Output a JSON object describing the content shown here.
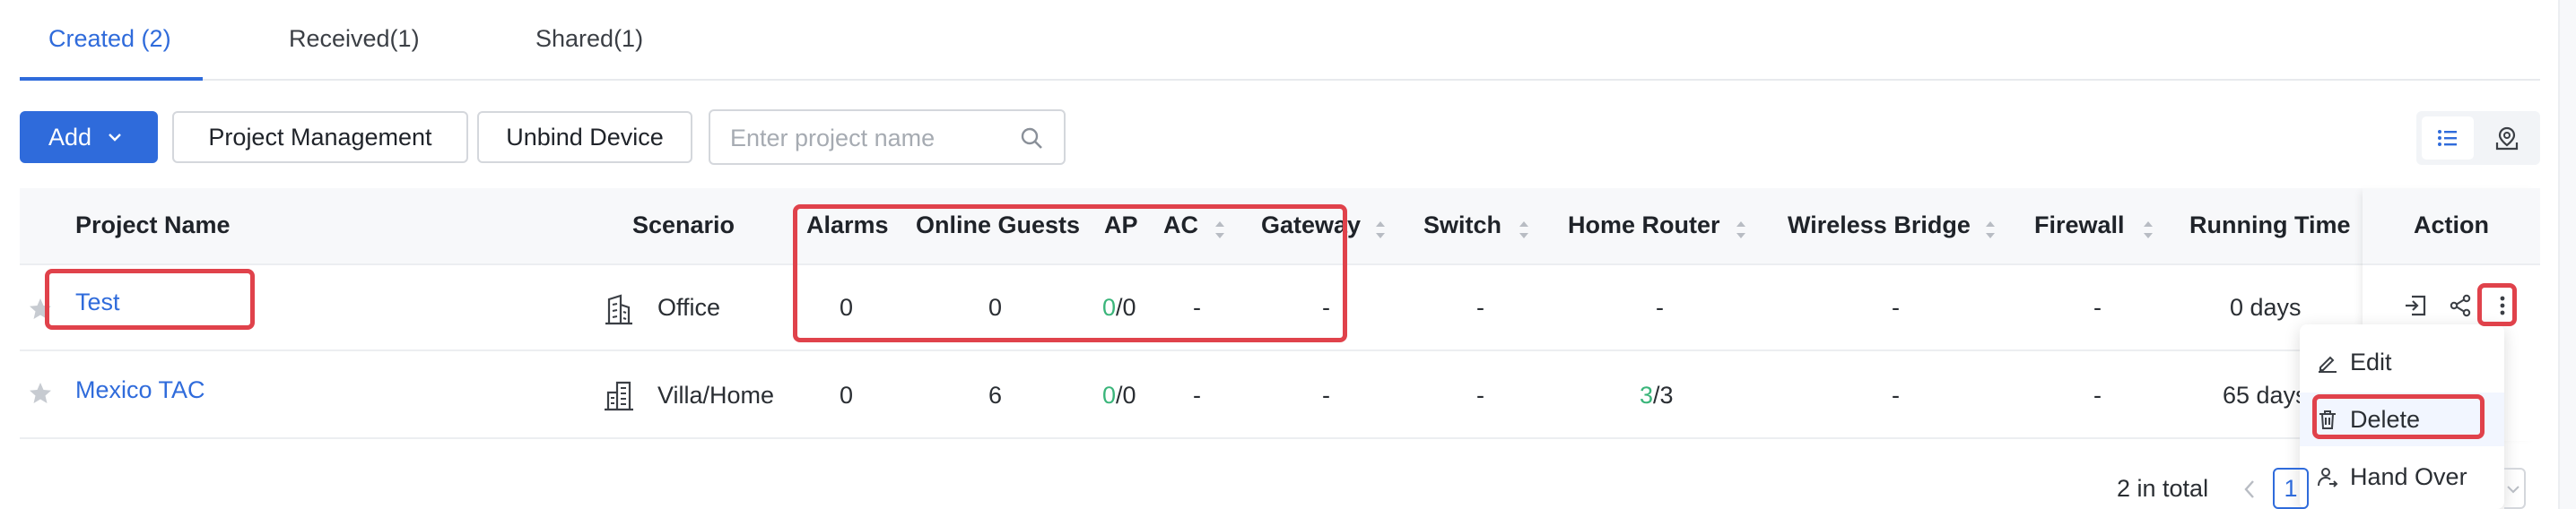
{
  "tabs": [
    {
      "label": "Created (2)",
      "active": true
    },
    {
      "label": "Received(1)",
      "active": false
    },
    {
      "label": "Shared(1)",
      "active": false
    }
  ],
  "toolbar": {
    "add_label": "Add",
    "project_management_label": "Project Management",
    "unbind_device_label": "Unbind Device",
    "search_placeholder": "Enter project name",
    "view_modes": [
      "list-icon",
      "map-pin-icon"
    ]
  },
  "table": {
    "headers": {
      "project_name": "Project Name",
      "scenario": "Scenario",
      "alarms": "Alarms",
      "online_guests": "Online Guests",
      "ap": "AP",
      "ac": "AC",
      "gateway": "Gateway",
      "switch": "Switch",
      "home_router": "Home Router",
      "wireless_bridge": "Wireless Bridge",
      "firewall": "Firewall",
      "running_time": "Running Time",
      "action": "Action"
    },
    "rows": [
      {
        "name": "Test",
        "scenario": "Office",
        "scenario_icon": "office-building-icon",
        "alarms": "0",
        "online_guests": "0",
        "ap_online": "0",
        "ap_total": "/0",
        "ac": "-",
        "gateway": "-",
        "switch": "-",
        "home_router": "-",
        "home_router_online": "",
        "home_router_total": "",
        "wireless_bridge": "-",
        "firewall": "-",
        "running_time": "0 days"
      },
      {
        "name": "Mexico TAC",
        "scenario": "Villa/Home",
        "scenario_icon": "villa-icon",
        "alarms": "0",
        "online_guests": "6",
        "ap_online": "0",
        "ap_total": "/0",
        "ac": "-",
        "gateway": "-",
        "switch": "-",
        "home_router_online": "3",
        "home_router_total": "/3",
        "wireless_bridge": "-",
        "firewall": "-",
        "running_time": "65 days"
      }
    ]
  },
  "action_menu": {
    "items": [
      {
        "label": "Edit",
        "icon": "edit-icon"
      },
      {
        "label": "Delete",
        "icon": "trash-icon"
      },
      {
        "label": "Hand Over",
        "icon": "hand-over-icon"
      }
    ]
  },
  "pagination": {
    "total_text": "2 in total",
    "current_page": "1"
  },
  "colors": {
    "accent": "#2f6bdb",
    "online_green": "#3ab57a",
    "highlight_red": "#e0424b"
  }
}
